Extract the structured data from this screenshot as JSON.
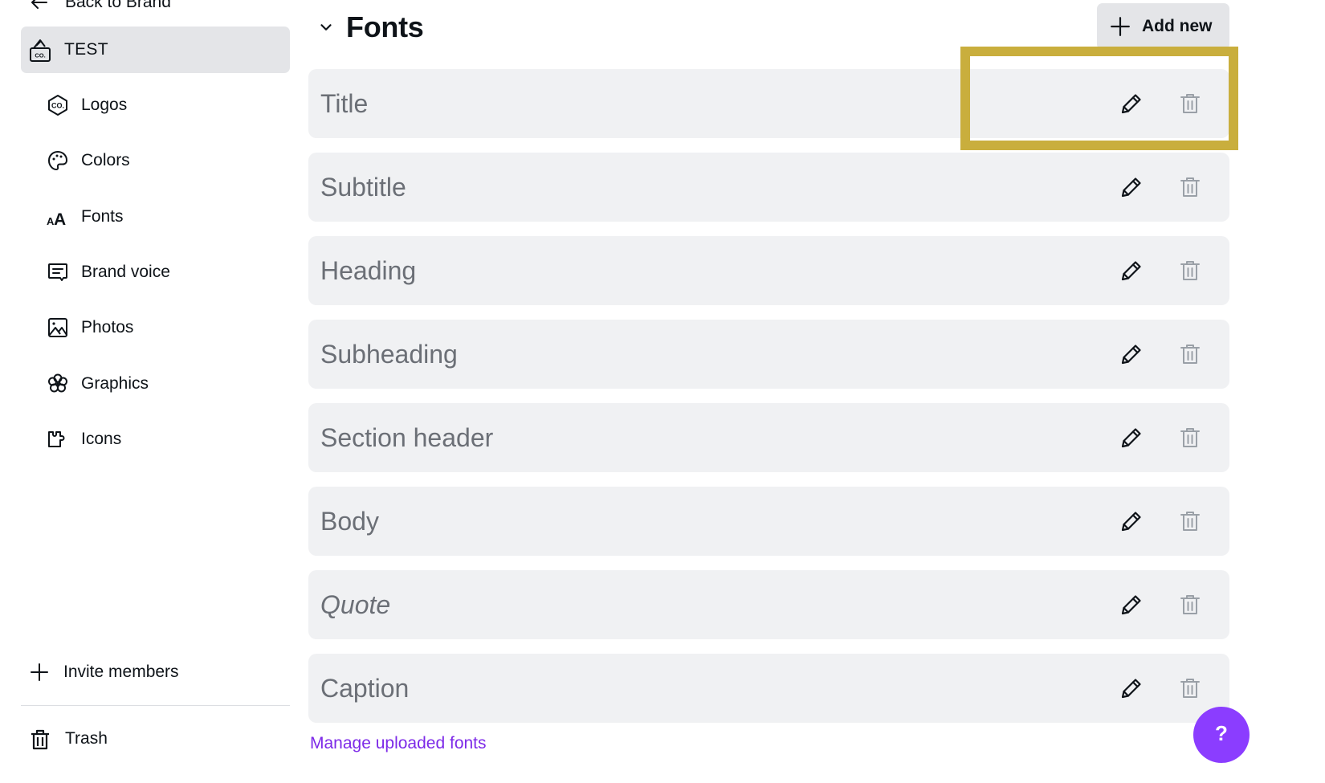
{
  "sidebar": {
    "back_label": "Back to Brand",
    "brand_kit": {
      "label": "TEST",
      "icon": "brand-kit-icon"
    },
    "items": [
      {
        "label": "Logos",
        "icon": "logo-hexagon-icon"
      },
      {
        "label": "Colors",
        "icon": "palette-icon"
      },
      {
        "label": "Fonts",
        "icon": "font-size-icon"
      },
      {
        "label": "Brand voice",
        "icon": "message-icon"
      },
      {
        "label": "Photos",
        "icon": "image-icon"
      },
      {
        "label": "Graphics",
        "icon": "flower-icon"
      },
      {
        "label": "Icons",
        "icon": "puzzle-icon"
      }
    ],
    "invite_label": "Invite members",
    "trash_label": "Trash"
  },
  "main": {
    "section_title": "Fonts",
    "add_new_label": "Add new",
    "font_styles": [
      {
        "name": "Title",
        "italic": false
      },
      {
        "name": "Subtitle",
        "italic": false
      },
      {
        "name": "Heading",
        "italic": false
      },
      {
        "name": "Subheading",
        "italic": false
      },
      {
        "name": "Section header",
        "italic": false
      },
      {
        "name": "Body",
        "italic": false
      },
      {
        "name": "Quote",
        "italic": true
      },
      {
        "name": "Caption",
        "italic": false
      }
    ],
    "manage_link_label": "Manage uploaded fonts"
  },
  "help": {
    "label": "?"
  },
  "colors": {
    "accent": "#8b3dff",
    "link": "#7d2ae8",
    "highlight": "#c9ae3d",
    "row_bg": "#f0f1f3",
    "selected_bg": "#e4e5e8"
  }
}
